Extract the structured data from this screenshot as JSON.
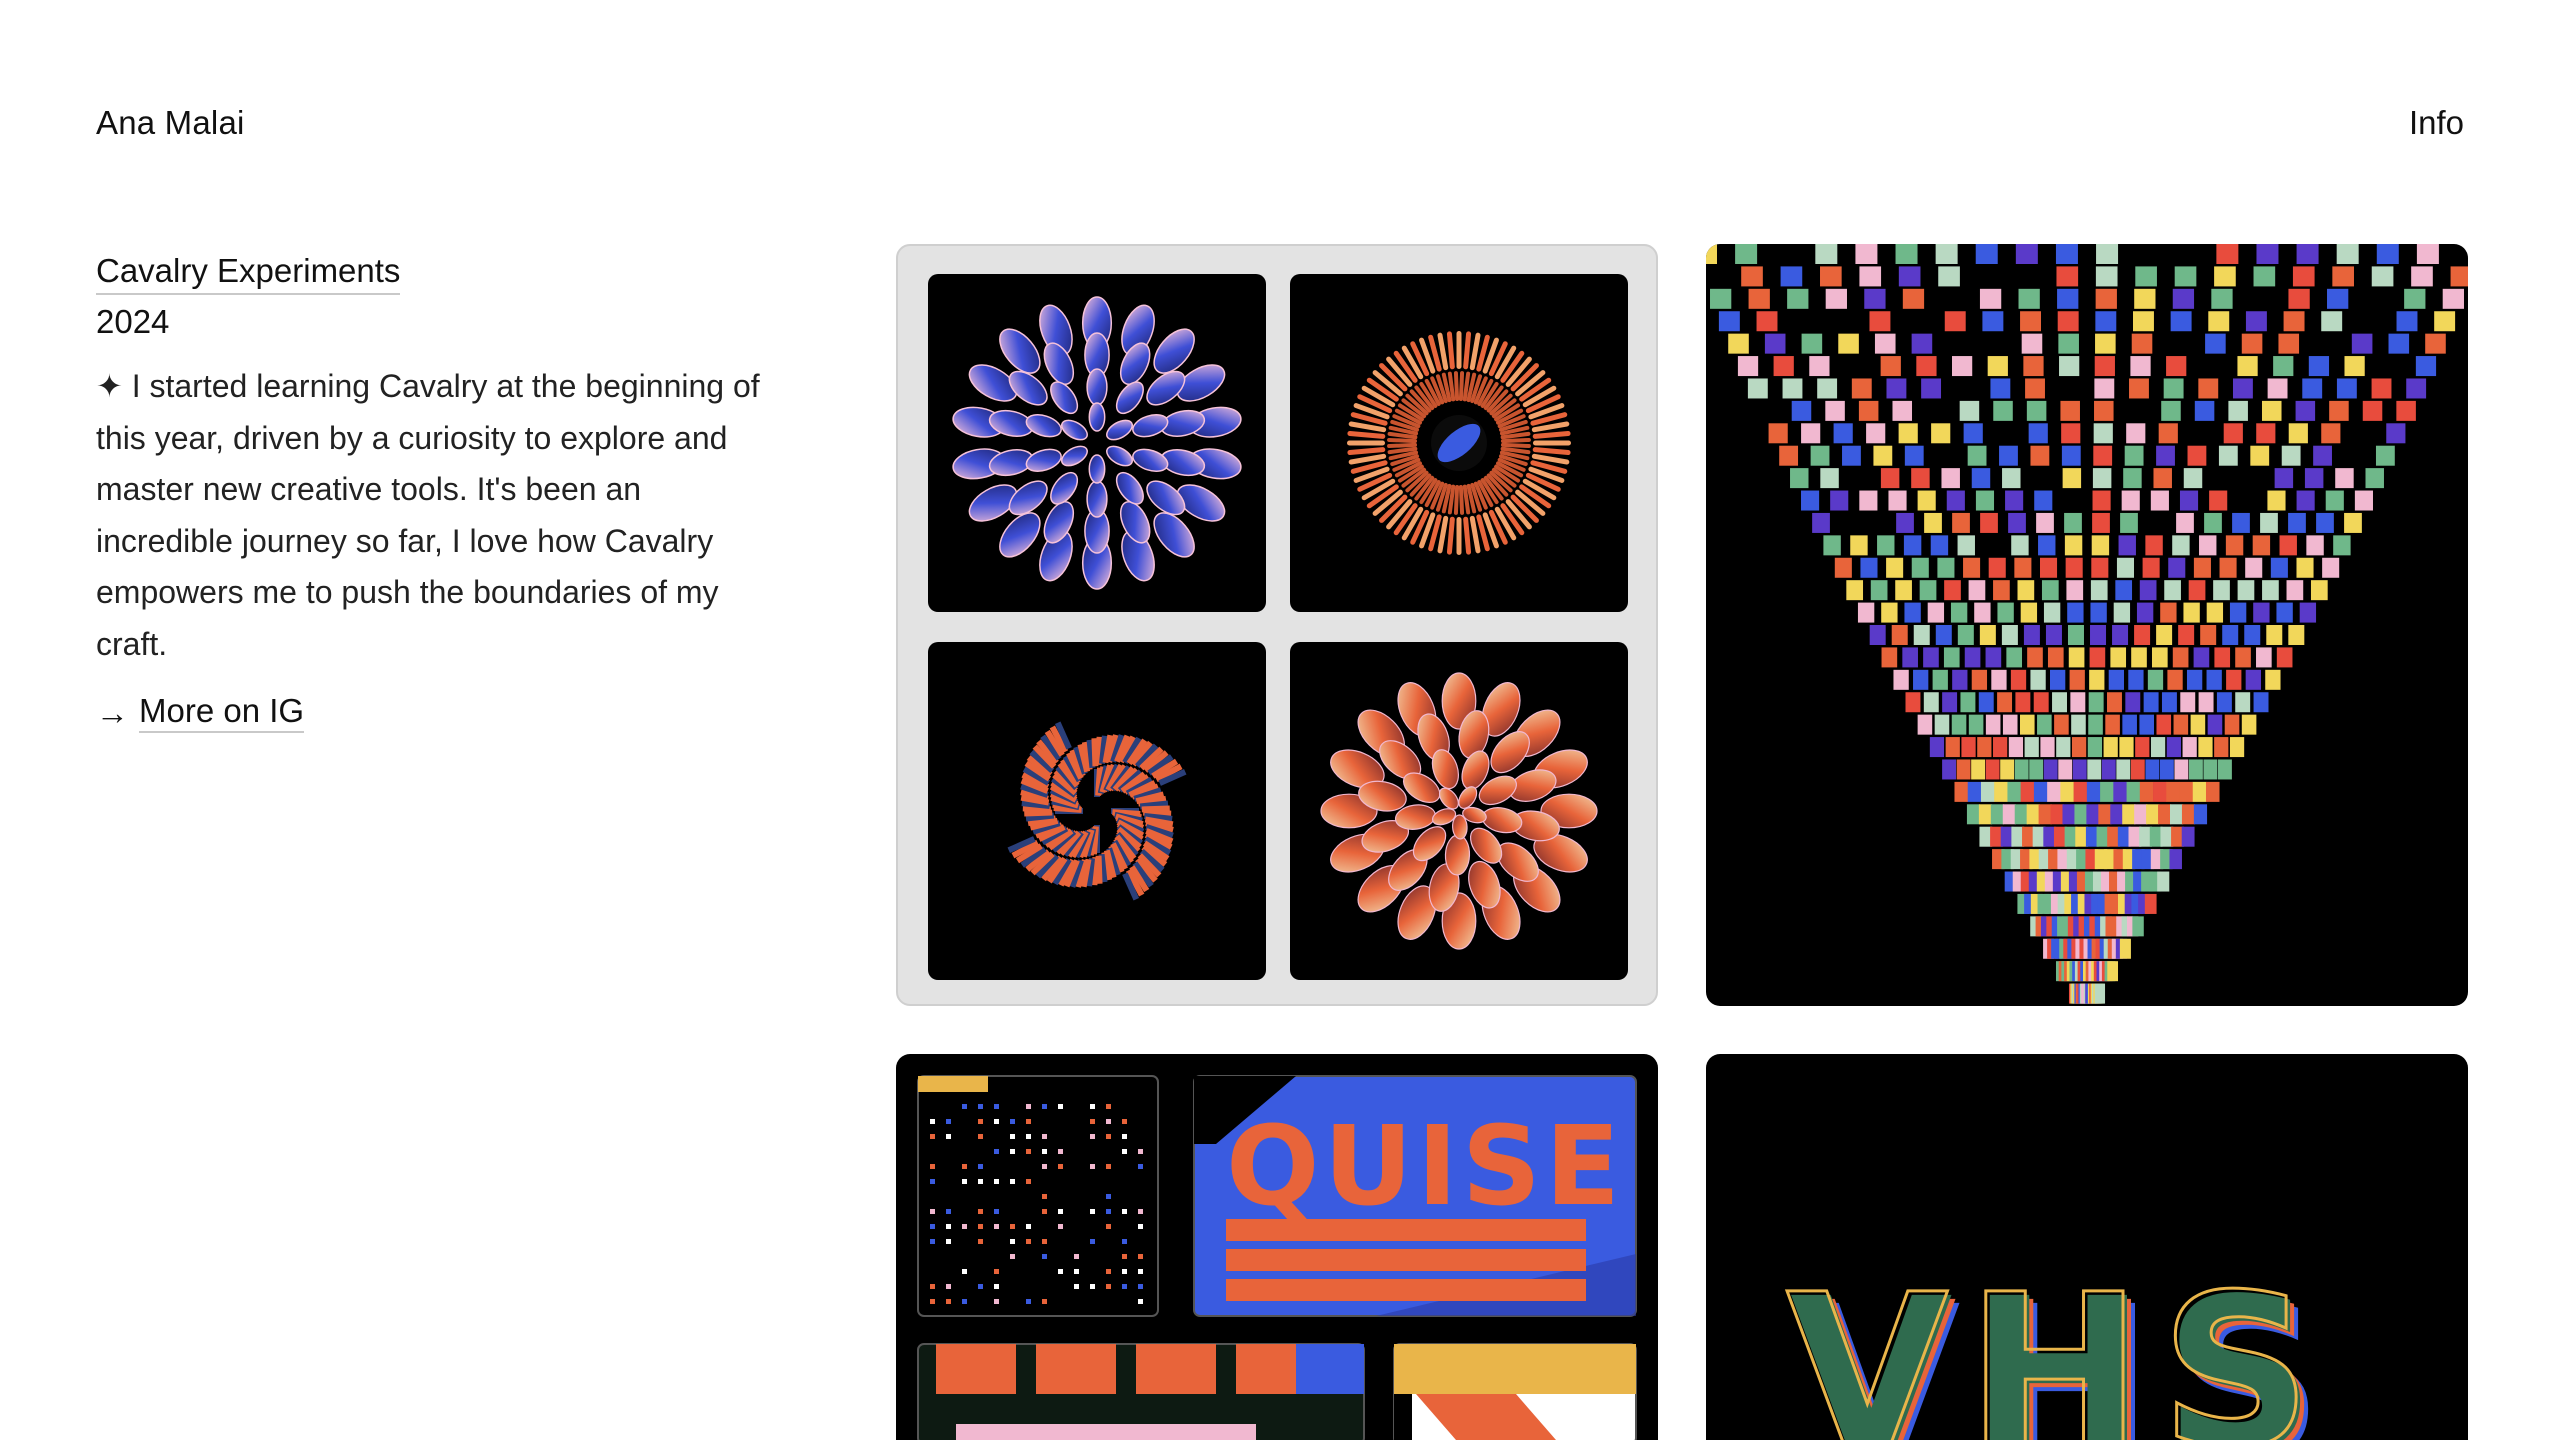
{
  "header": {
    "site_name": "Ana Malai",
    "info_label": "Info"
  },
  "project": {
    "title": "Cavalry Experiments",
    "year": "2024",
    "description": "✦ I started learning Cavalry at the beginning of this year, driven by a curiosity to explore and master new creative tools. It's been an incredible journey so far, I love how Cavalry empowers me to push the boundaries of my craft.",
    "more_arrow": "→",
    "more_label": "More on IG"
  },
  "gallery": {
    "tiles": [
      {
        "name": "four-renders-grid"
      },
      {
        "name": "pixel-streams"
      },
      {
        "name": "typography-grid"
      },
      {
        "name": "vhs-type"
      }
    ],
    "texts": {
      "quise": "QUISE",
      "vhs": "VHS"
    }
  },
  "colors": {
    "background": "#ffffff",
    "text": "#111111",
    "underline": "#c9c9c9",
    "tile_bg": "#000000",
    "card_bg": "#e3e3e3",
    "accent_blue": "#3a5be0",
    "accent_orange": "#e8643a",
    "accent_pink": "#f1b8d0",
    "accent_green": "#6fb88a",
    "accent_yellow": "#f2d75a"
  }
}
